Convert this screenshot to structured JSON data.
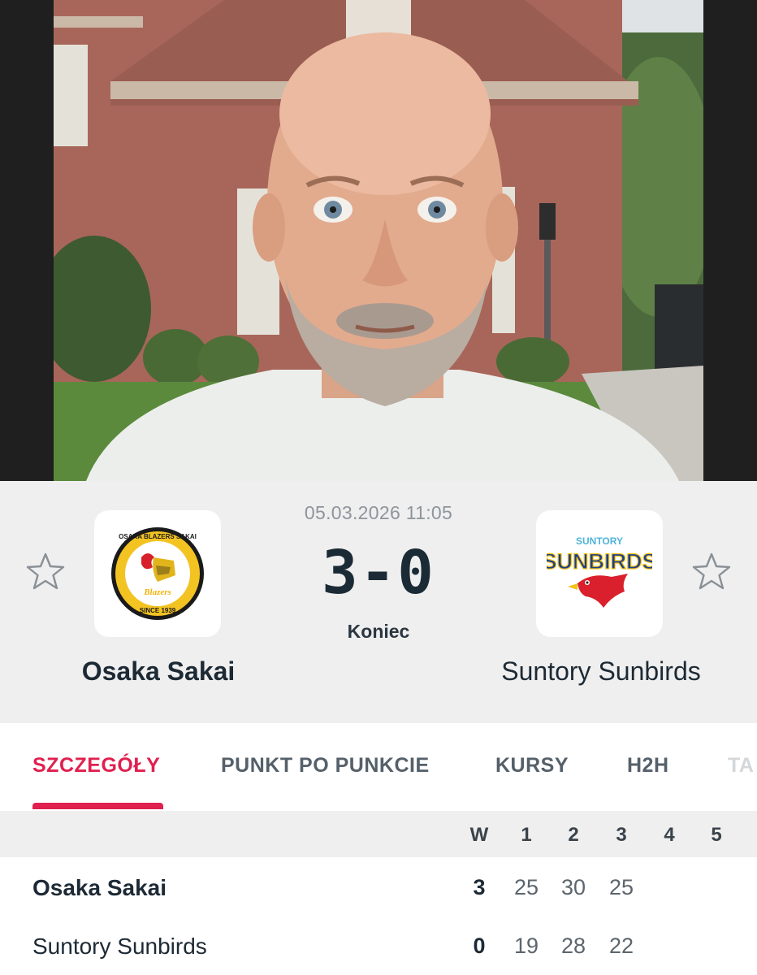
{
  "match": {
    "datetime": "05.03.2026 11:05",
    "score": "3-0",
    "status": "Koniec",
    "home": {
      "name": "Osaka Sakai",
      "logo_text": "OSAKA BLAZERS SAKAI",
      "logo_since": "SINCE 1939",
      "logo_wordmark": "Blazers"
    },
    "away": {
      "name": "Suntory Sunbirds",
      "logo_top": "SUNTORY",
      "logo_main": "SUNBIRDS"
    }
  },
  "tabs": [
    {
      "label": "SZCZEGÓŁY",
      "active": true
    },
    {
      "label": "PUNKT PO PUNKCIE"
    },
    {
      "label": "KURSY"
    },
    {
      "label": "H2H"
    },
    {
      "label": "TA"
    }
  ],
  "table": {
    "headers": [
      "W",
      "1",
      "2",
      "3",
      "4",
      "5"
    ],
    "rows": [
      {
        "team": "Osaka Sakai",
        "w": "3",
        "sets": [
          "25",
          "30",
          "25",
          "",
          ""
        ]
      },
      {
        "team": "Suntory Sunbirds",
        "w": "0",
        "sets": [
          "19",
          "28",
          "22",
          "",
          ""
        ]
      }
    ]
  },
  "colors": {
    "accent": "#e0204f",
    "header_bg": "#efefef",
    "text": "#1d2a35"
  },
  "icons": {
    "favorite": "star-outline-icon"
  }
}
